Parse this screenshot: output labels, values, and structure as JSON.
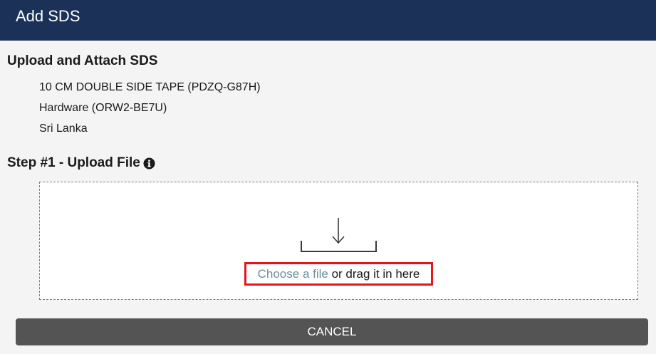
{
  "dialog": {
    "title": "Add SDS"
  },
  "upload_section": {
    "heading": "Upload and Attach SDS",
    "product": "10 CM DOUBLE SIDE TAPE (PDZQ-G87H)",
    "category": "Hardware (ORW2-BE7U)",
    "country": "Sri Lanka"
  },
  "step1": {
    "title": "Step #1 - Upload File",
    "info_icon": "info-circle-icon"
  },
  "dropzone": {
    "icon": "download-tray-icon",
    "choose_link": "Choose a file",
    "drag_text": " or drag it in here"
  },
  "actions": {
    "cancel_label": "CANCEL"
  },
  "colors": {
    "header_bg": "#1b3158",
    "link": "#6a8fa0",
    "highlight_border": "#e6141b",
    "cancel_bg": "#545454"
  }
}
